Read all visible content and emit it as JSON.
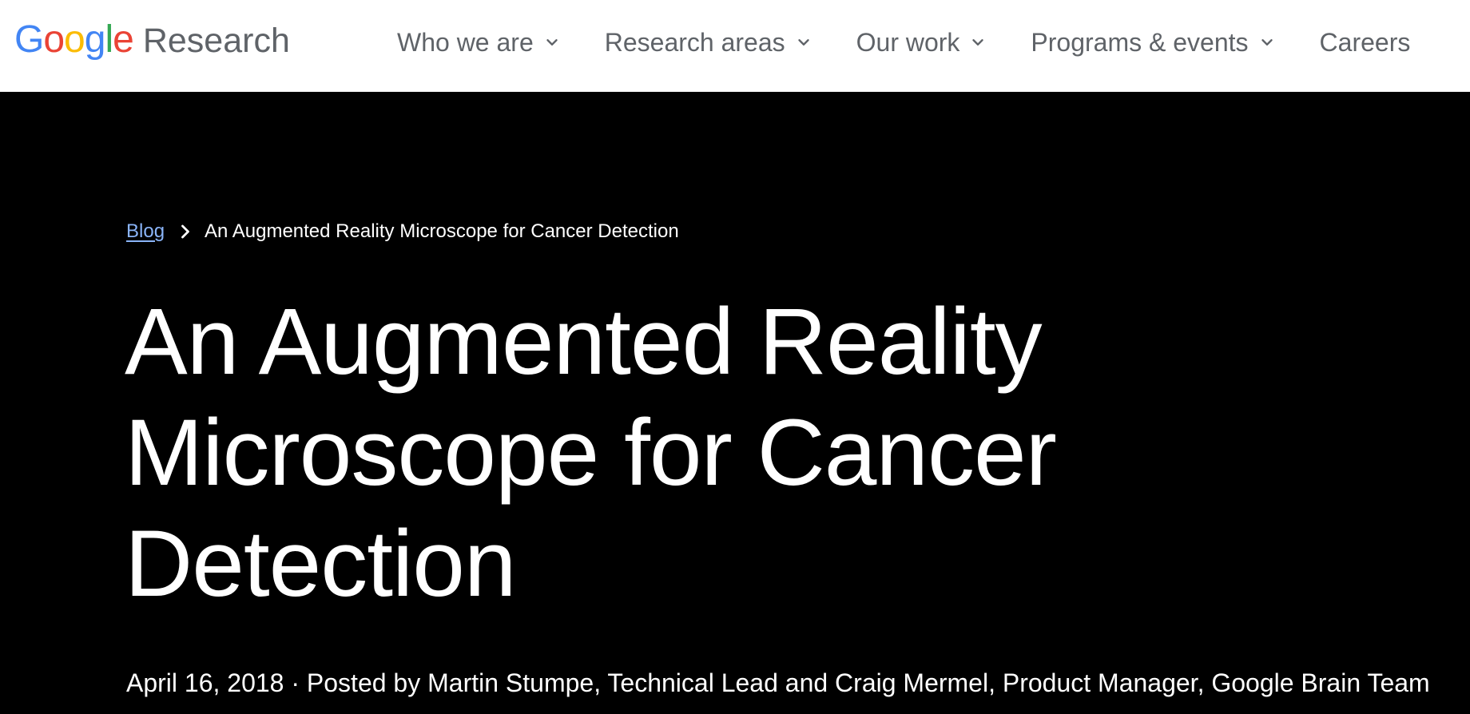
{
  "header": {
    "logo_letters": [
      {
        "char": "G",
        "color": "#4285F4"
      },
      {
        "char": "o",
        "color": "#EA4335"
      },
      {
        "char": "o",
        "color": "#FBBC05"
      },
      {
        "char": "g",
        "color": "#4285F4"
      },
      {
        "char": "l",
        "color": "#34A853"
      },
      {
        "char": "e",
        "color": "#EA4335"
      }
    ],
    "brand_suffix": "Research",
    "nav": [
      {
        "label": "Who we are",
        "has_dropdown": true,
        "icon": "chevron-down-icon"
      },
      {
        "label": "Research areas",
        "has_dropdown": true,
        "icon": "chevron-down-icon"
      },
      {
        "label": "Our work",
        "has_dropdown": true,
        "icon": "chevron-down-icon"
      },
      {
        "label": "Programs & events",
        "has_dropdown": true,
        "icon": "chevron-down-icon"
      },
      {
        "label": "Careers",
        "has_dropdown": false
      }
    ]
  },
  "breadcrumb": {
    "parent": "Blog",
    "separator_icon": "chevron-right-icon",
    "current": "An Augmented Reality Microscope for Cancer Detection"
  },
  "article": {
    "title": "An Augmented Reality Microscope for Cancer Detection",
    "meta": "April 16, 2018 · Posted by Martin Stumpe, Technical Lead and Craig Mermel, Product Manager, Google Brain Team"
  },
  "colors": {
    "nav_text": "#5f6368",
    "link": "#8ab4f8",
    "hero_background": "#000000",
    "header_background": "#ffffff"
  }
}
